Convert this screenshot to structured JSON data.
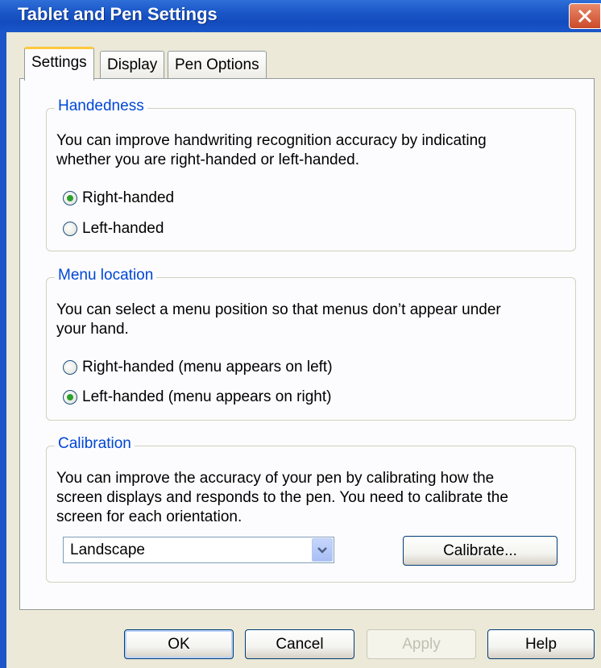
{
  "window": {
    "title": "Tablet and Pen Settings"
  },
  "tabs": [
    {
      "label": "Settings",
      "active": true
    },
    {
      "label": "Display",
      "active": false
    },
    {
      "label": "Pen Options",
      "active": false
    }
  ],
  "handedness": {
    "legend": "Handedness",
    "desc_line1": "You can improve handwriting recognition accuracy by indicating",
    "desc_line2": "whether you are right-handed or left-handed.",
    "options": [
      {
        "label": "Right-handed",
        "checked": true
      },
      {
        "label": "Left-handed",
        "checked": false
      }
    ]
  },
  "menu_location": {
    "legend": "Menu location",
    "desc_line1": "You can select a menu position so that menus don’t appear under",
    "desc_line2": "your hand.",
    "options": [
      {
        "label": "Right-handed (menu appears on left)",
        "checked": false
      },
      {
        "label": "Left-handed (menu appears on right)",
        "checked": true
      }
    ]
  },
  "calibration": {
    "legend": "Calibration",
    "desc_line1": "You can improve the accuracy of your pen by calibrating how the",
    "desc_line2": "screen displays and responds to the pen. You need to calibrate the",
    "desc_line3": "screen for each orientation.",
    "orientation_value": "Landscape",
    "calibrate_label": "Calibrate..."
  },
  "buttons": {
    "ok": "OK",
    "cancel": "Cancel",
    "apply": "Apply",
    "help": "Help"
  },
  "colors": {
    "titlebar": "#1a56c7",
    "legend_text": "#0046d5",
    "radio_dot": "#2aa12a",
    "close_button": "#cc4a2a"
  }
}
